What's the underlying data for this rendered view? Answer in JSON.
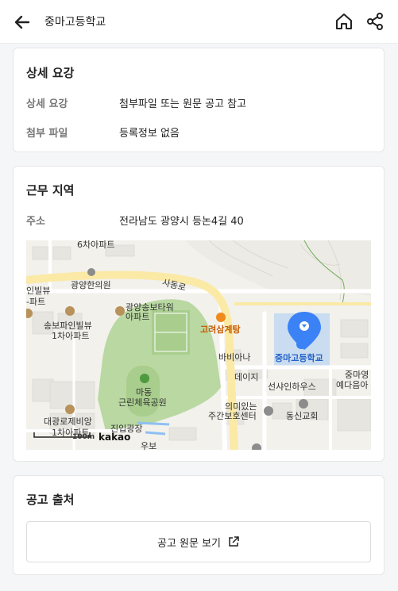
{
  "header": {
    "title": "중마고등학교",
    "back_icon": "back-arrow-icon",
    "home_icon": "home-icon",
    "share_icon": "share-icon"
  },
  "details": {
    "title": "상세 요강",
    "rows": [
      {
        "label": "상세 요강",
        "value": "첨부파일 또는 원문 공고 참고"
      },
      {
        "label": "첨부 파일",
        "value": "등록정보 없음"
      }
    ]
  },
  "location": {
    "title": "근무 지역",
    "address_label": "주소",
    "address_value": "전라남도 광양시 등논4길 40",
    "map": {
      "labels": {
        "l1": "6차아파트",
        "l2": "광양한의원",
        "l3": "사동로",
        "l4": "인빌뷰",
        "l5": "-파트",
        "l6": "광양송보타워",
        "l7": "아파트",
        "l8": "송보파인빌뷰",
        "l9": "1차아파트",
        "l10": "고려삼계탕",
        "l11": "바비아나",
        "l12": "중마고등학교",
        "l13": "중마영",
        "l14": "예다음아",
        "l15": "데이지",
        "l16": "선샤인하우스",
        "l17": "마동",
        "l18": "근린체육공원",
        "l19": "의미있는",
        "l20": "주간보호센터",
        "l21": "동신교회",
        "l22": "대광로제비앙",
        "l23": "1차아파트",
        "l24": "진입광장",
        "l25": "우보",
        "scale": "100m",
        "brand": "kakao"
      },
      "colors": {
        "background": "#f2f1ec",
        "road": "#ffffff",
        "main_road": "#fbe9a6",
        "park": "#b9d8a2",
        "pin": "#3b82f6",
        "school": "#c9dcf0"
      }
    }
  },
  "source": {
    "title": "공고 출처",
    "button_label": "공고 원문 보기",
    "button_icon": "external-link-icon"
  }
}
